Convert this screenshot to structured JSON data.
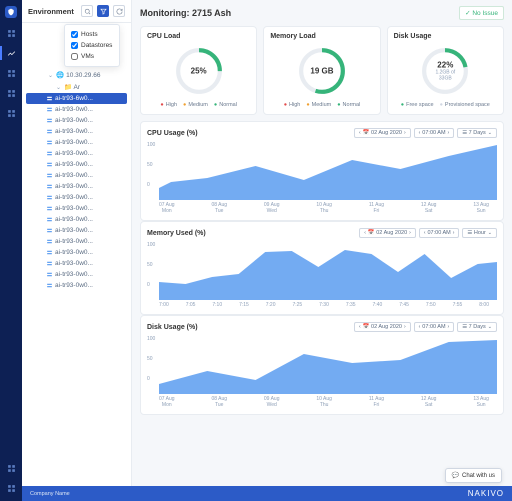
{
  "sidebar": {
    "title": "Environment",
    "filter": {
      "hosts_label": "Hosts",
      "datastores_label": "Datastores",
      "vms_label": "VMs"
    },
    "ip_node": "10.30.29.66",
    "hosts": [
      "ai-tr93-6w0...",
      "ai-tr93-0w0...",
      "ai-tr93-0w0...",
      "ai-tr93-0w0...",
      "ai-tr93-0w0...",
      "ai-tr93-0w0...",
      "ai-tr93-0w0...",
      "ai-tr93-0w0...",
      "ai-tr93-0w0...",
      "ai-tr93-0w0...",
      "ai-tr93-0w0...",
      "ai-tr93-0w0...",
      "ai-tr93-0w0...",
      "ai-tr93-0w0...",
      "ai-tr93-0w0...",
      "ai-tr93-0w0...",
      "ai-tr93-0w0...",
      "ai-tr93-0w0..."
    ]
  },
  "monitoring": {
    "title": "Monitoring: 2715 Ash",
    "status": "No Issue",
    "cards": {
      "cpu": {
        "title": "CPU Load",
        "value": "25%",
        "pct": 25
      },
      "mem": {
        "title": "Memory Load",
        "value": "19 GB",
        "pct": 55
      },
      "disk": {
        "title": "Disk Usage",
        "value": "22%",
        "sub": "1.2GB of 33GB",
        "pct": 22
      }
    },
    "legend": {
      "high": "High",
      "medium": "Medium",
      "normal": "Normal",
      "free": "Free space",
      "prov": "Provisioned space"
    }
  },
  "charts": [
    {
      "title": "CPU Usage (%)",
      "date": "02 Aug 2020",
      "time": "07:00 AM",
      "range": "7 Days"
    },
    {
      "title": "Memory Used (%)",
      "date": "02 Aug 2020",
      "time": "07:00 AM",
      "range": "Hour"
    },
    {
      "title": "Disk Usage (%)",
      "date": "02 Aug 2020",
      "time": "07:00 AM",
      "range": "7 Days"
    }
  ],
  "xaxis_days": [
    [
      "07 Aug",
      "Mon"
    ],
    [
      "08 Aug",
      "Tue"
    ],
    [
      "09 Aug",
      "Wed"
    ],
    [
      "10 Aug",
      "Thu"
    ],
    [
      "11 Aug",
      "Fri"
    ],
    [
      "12 Aug",
      "Sat"
    ],
    [
      "13 Aug",
      "Sun"
    ]
  ],
  "xaxis_hour": [
    "7:00",
    "7:05",
    "7:10",
    "7:15",
    "7:20",
    "7:25",
    "7:30",
    "7:35",
    "7:40",
    "7:45",
    "7:50",
    "7:55",
    "8:00"
  ],
  "yaxis": [
    "100",
    "50",
    "0"
  ],
  "chart_data": [
    {
      "type": "area",
      "title": "CPU Usage (%)",
      "categories": [
        "07 Aug",
        "08 Aug",
        "09 Aug",
        "10 Aug",
        "11 Aug",
        "12 Aug",
        "13 Aug"
      ],
      "values": [
        20,
        55,
        30,
        70,
        55,
        78,
        95
      ],
      "ylim": [
        0,
        100
      ]
    },
    {
      "type": "area",
      "title": "Memory Used (%)",
      "categories": [
        "7:00",
        "7:05",
        "7:10",
        "7:15",
        "7:20",
        "7:25",
        "7:30",
        "7:35",
        "7:40",
        "7:45",
        "7:50",
        "7:55",
        "8:00"
      ],
      "values": [
        30,
        28,
        40,
        45,
        82,
        85,
        60,
        88,
        80,
        50,
        80,
        40,
        65
      ],
      "ylim": [
        0,
        100
      ]
    },
    {
      "type": "area",
      "title": "Disk Usage (%)",
      "categories": [
        "07 Aug",
        "08 Aug",
        "09 Aug",
        "10 Aug",
        "11 Aug",
        "12 Aug",
        "13 Aug"
      ],
      "values": [
        18,
        40,
        25,
        70,
        55,
        60,
        90
      ],
      "ylim": [
        0,
        100
      ]
    }
  ],
  "footer": {
    "company": "Company Name",
    "brand": "NAKIVO"
  },
  "chat": "Chat with us"
}
